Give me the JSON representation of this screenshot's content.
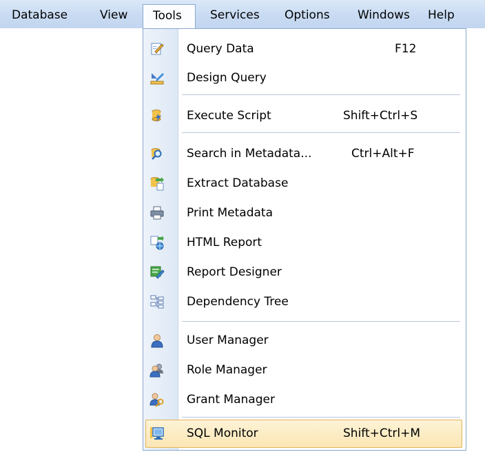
{
  "menubar": {
    "database": "Database",
    "view": "View",
    "tools": "Tools",
    "services": "Services",
    "options": "Options",
    "windows": "Windows",
    "help": "Help"
  },
  "menu": {
    "items": [
      {
        "label": "Query Data",
        "shortcut": "F12",
        "icon": "query-data-icon"
      },
      {
        "label": "Design Query",
        "shortcut": "",
        "icon": "design-query-icon"
      },
      {
        "label": "Execute Script",
        "shortcut": "Shift+Ctrl+S",
        "icon": "execute-script-icon"
      },
      {
        "label": "Search in Metadata...",
        "shortcut": "Ctrl+Alt+F",
        "icon": "search-metadata-icon"
      },
      {
        "label": "Extract Database",
        "shortcut": "",
        "icon": "extract-database-icon"
      },
      {
        "label": "Print Metadata",
        "shortcut": "",
        "icon": "printer-icon"
      },
      {
        "label": "HTML Report",
        "shortcut": "",
        "icon": "html-report-icon"
      },
      {
        "label": "Report Designer",
        "shortcut": "",
        "icon": "report-designer-icon"
      },
      {
        "label": "Dependency Tree",
        "shortcut": "",
        "icon": "dependency-tree-icon"
      },
      {
        "label": "User Manager",
        "shortcut": "",
        "icon": "user-icon"
      },
      {
        "label": "Role Manager",
        "shortcut": "",
        "icon": "role-icon"
      },
      {
        "label": "Grant Manager",
        "shortcut": "",
        "icon": "grant-icon"
      },
      {
        "label": "SQL Monitor",
        "shortcut": "Shift+Ctrl+M",
        "icon": "monitor-icon"
      }
    ]
  },
  "colors": {
    "menubar_bg": "#c7daf2",
    "highlight_bg": "#fbe6b4",
    "highlight_border": "#e2b35a",
    "border": "#8aa7cf"
  }
}
